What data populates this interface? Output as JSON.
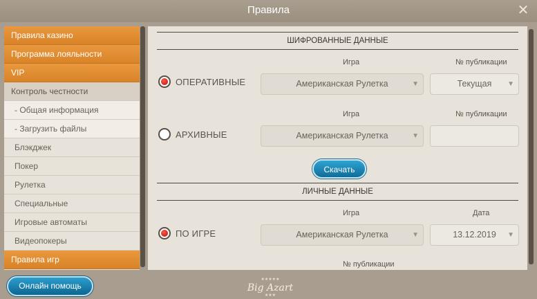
{
  "window": {
    "title": "Правила"
  },
  "sidebar": {
    "items": [
      {
        "label": "Правила казино"
      },
      {
        "label": "Программа лояльности"
      },
      {
        "label": "VIP"
      },
      {
        "label": "Контроль честности"
      },
      {
        "label": "- Общая информация"
      },
      {
        "label": "- Загрузить файлы"
      },
      {
        "label": "Блэкджек"
      },
      {
        "label": "Покер"
      },
      {
        "label": "Рулетка"
      },
      {
        "label": "Специальные"
      },
      {
        "label": "Игровые автоматы"
      },
      {
        "label": "Видеопокеры"
      },
      {
        "label": "Правила игр"
      }
    ]
  },
  "encrypted": {
    "title": "ШИФРОВАННЫЕ ДАННЫЕ",
    "game_label": "Игра",
    "pub_label": "№ публикации",
    "operational": {
      "label": "ОПЕРАТИВНЫЕ",
      "selected": true,
      "game": "Американская Рулетка",
      "publication": "Текущая"
    },
    "archive": {
      "label": "АРХИВНЫЕ",
      "selected": false,
      "game": "Американская Рулетка",
      "publication": ""
    },
    "download_label": "Скачать"
  },
  "personal": {
    "title": "ЛИЧНЫЕ ДАННЫЕ",
    "game_label": "Игра",
    "date_label": "Дата",
    "pub_label": "№ публикации",
    "by_game": {
      "label": "ПО ИГРЕ",
      "selected": true,
      "game": "Американская Рулетка",
      "date": "13.12.2019"
    }
  },
  "footer": {
    "help_label": "Онлайн помощь",
    "logo_text": "Big Azart"
  },
  "colors": {
    "accent_orange": "#e08d33",
    "button_blue": "#1f86b5",
    "panel_bg": "#e7e2da",
    "frame_bg": "#a89d8e"
  }
}
